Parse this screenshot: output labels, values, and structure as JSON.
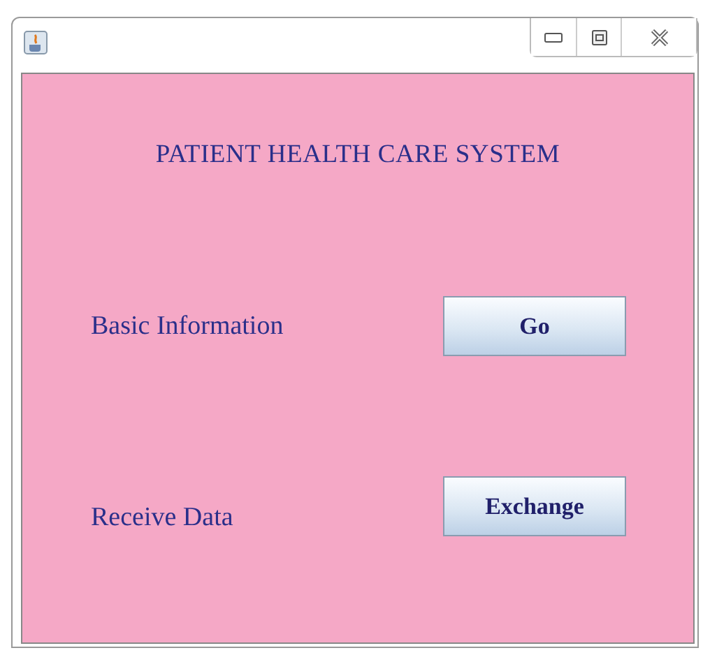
{
  "heading": "PATIENT HEALTH CARE SYSTEM",
  "rows": [
    {
      "label": "Basic Information",
      "button": "Go"
    },
    {
      "label": "Receive Data",
      "button": "Exchange"
    }
  ]
}
